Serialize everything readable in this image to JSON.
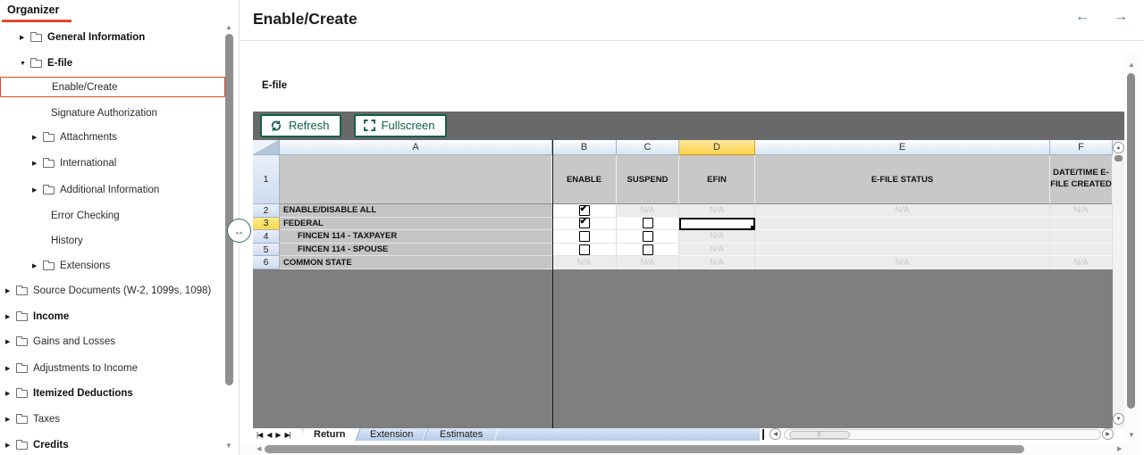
{
  "icons": {
    "back": "←",
    "forward": "→",
    "resize": "↔",
    "collapsed": "▶",
    "expanded": "▼",
    "up": "▲",
    "down": "▼",
    "left": "◀",
    "right": "▶",
    "tab_first": "|◀",
    "tab_prev": "◀",
    "tab_next": "▶",
    "tab_last": "▶|",
    "check": "✔",
    "grip": "||"
  },
  "colors": {
    "accent_red": "#e8472b",
    "button_green": "#11604a",
    "selected_yellow": "#fbd34a",
    "toolbar_gray": "#696969",
    "header_gray": "#c8c8c8"
  },
  "sidebar": {
    "tab_label": "Organizer",
    "items": [
      {
        "label": "General Information"
      },
      {
        "label": "E-file"
      },
      {
        "label": "Enable/Create"
      },
      {
        "label": "Signature Authorization"
      },
      {
        "label": "Attachments"
      },
      {
        "label": "International"
      },
      {
        "label": "Additional Information"
      },
      {
        "label": "Error Checking"
      },
      {
        "label": "History"
      },
      {
        "label": "Extensions"
      },
      {
        "label": "Source Documents (W-2, 1099s, 1098)"
      },
      {
        "label": "Income"
      },
      {
        "label": "Gains and Losses"
      },
      {
        "label": "Adjustments to Income"
      },
      {
        "label": "Itemized Deductions"
      },
      {
        "label": "Taxes"
      },
      {
        "label": "Credits"
      }
    ]
  },
  "header": {
    "title": "Enable/Create"
  },
  "content": {
    "section_label": "E-file"
  },
  "toolbar": {
    "refresh_label": "Refresh",
    "fullscreen_label": "Fullscreen"
  },
  "grid": {
    "column_letters": [
      "A",
      "B",
      "C",
      "D",
      "E",
      "F"
    ],
    "selected_column": "D",
    "selected_row": 3,
    "na_text": "N/A",
    "header_row": {
      "number": "1",
      "enable": "ENABLE",
      "suspend": "SUSPEND",
      "efin": "EFIN",
      "status": "E-FILE STATUS",
      "datetime": "DATE/TIME E-FILE CREATED"
    },
    "rows": [
      {
        "number": "2",
        "label": "ENABLE/DISABLE ALL",
        "enable": "checked",
        "suspend": "na",
        "efin": "na",
        "status": "na",
        "datetime": "na"
      },
      {
        "number": "3",
        "label": "FEDERAL",
        "enable": "checked",
        "suspend": "unchecked",
        "efin": "selected-empty",
        "status": "",
        "datetime": ""
      },
      {
        "number": "4",
        "label": "FINCEN 114 - TAXPAYER",
        "enable": "unchecked",
        "suspend": "unchecked",
        "efin": "na",
        "status": "",
        "datetime": ""
      },
      {
        "number": "5",
        "label": "FINCEN 114 - SPOUSE",
        "enable": "unchecked",
        "suspend": "unchecked",
        "efin": "na",
        "status": "",
        "datetime": ""
      },
      {
        "number": "6",
        "label": "COMMON STATE",
        "enable": "na",
        "suspend": "na",
        "efin": "na",
        "status": "na",
        "datetime": "na"
      }
    ]
  },
  "sheet_tabs": {
    "active": "Return",
    "tabs": [
      {
        "label": "Return"
      },
      {
        "label": "Extension"
      },
      {
        "label": "Estimates"
      }
    ]
  }
}
